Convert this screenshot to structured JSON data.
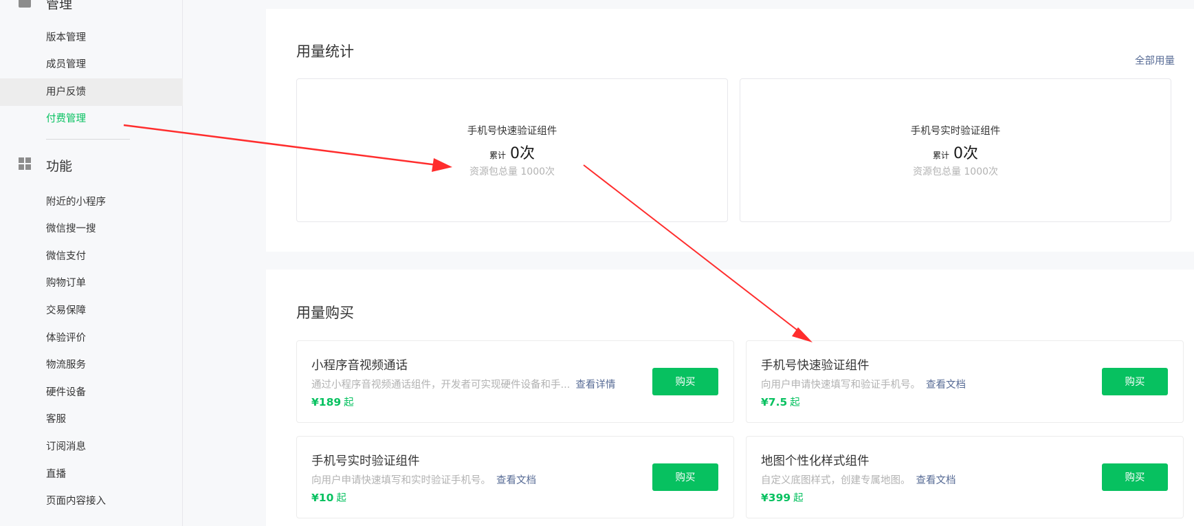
{
  "sidebar": {
    "group_manage": {
      "icon": "box-icon",
      "label": "管理"
    },
    "manage_items": [
      {
        "label": "版本管理"
      },
      {
        "label": "成员管理"
      },
      {
        "label": "用户反馈"
      },
      {
        "label": "付费管理"
      }
    ],
    "group_feature": {
      "icon": "grid-icon",
      "label": "功能"
    },
    "feature_items": [
      {
        "label": "附近的小程序"
      },
      {
        "label": "微信搜一搜"
      },
      {
        "label": "微信支付"
      },
      {
        "label": "购物订单"
      },
      {
        "label": "交易保障"
      },
      {
        "label": "体验评价"
      },
      {
        "label": "物流服务"
      },
      {
        "label": "硬件设备"
      },
      {
        "label": "客服"
      },
      {
        "label": "订阅消息"
      },
      {
        "label": "直播"
      },
      {
        "label": "页面内容接入"
      }
    ]
  },
  "usage_stats": {
    "title": "用量统计",
    "all_link": "全部用量",
    "cards": [
      {
        "name": "手机号快速验证组件",
        "count_prefix": "累计",
        "count": "0次",
        "total": "资源包总量 1000次"
      },
      {
        "name": "手机号实时验证组件",
        "count_prefix": "累计",
        "count": "0次",
        "total": "资源包总量 1000次"
      }
    ]
  },
  "usage_buy": {
    "title": "用量购买",
    "buy_label": "购买",
    "cards": [
      {
        "name": "小程序音视频通话",
        "desc": "通过小程序音视频通话组件，开发者可实现硬件设备和手...",
        "link": "查看详情",
        "price": "¥189",
        "suffix": "起"
      },
      {
        "name": "手机号快速验证组件",
        "desc": "向用户申请快速填写和验证手机号。",
        "link": "查看文档",
        "price": "¥7.5",
        "suffix": "起"
      },
      {
        "name": "手机号实时验证组件",
        "desc": "向用户申请快速填写和实时验证手机号。",
        "link": "查看文档",
        "price": "¥10",
        "suffix": "起"
      },
      {
        "name": "地图个性化样式组件",
        "desc": "自定义底图样式，创建专属地图。",
        "link": "查看文档",
        "price": "¥399",
        "suffix": "起"
      }
    ]
  },
  "colors": {
    "accent": "#07c160",
    "link": "#576b95",
    "annotation_arrow": "#ff2d2d"
  }
}
